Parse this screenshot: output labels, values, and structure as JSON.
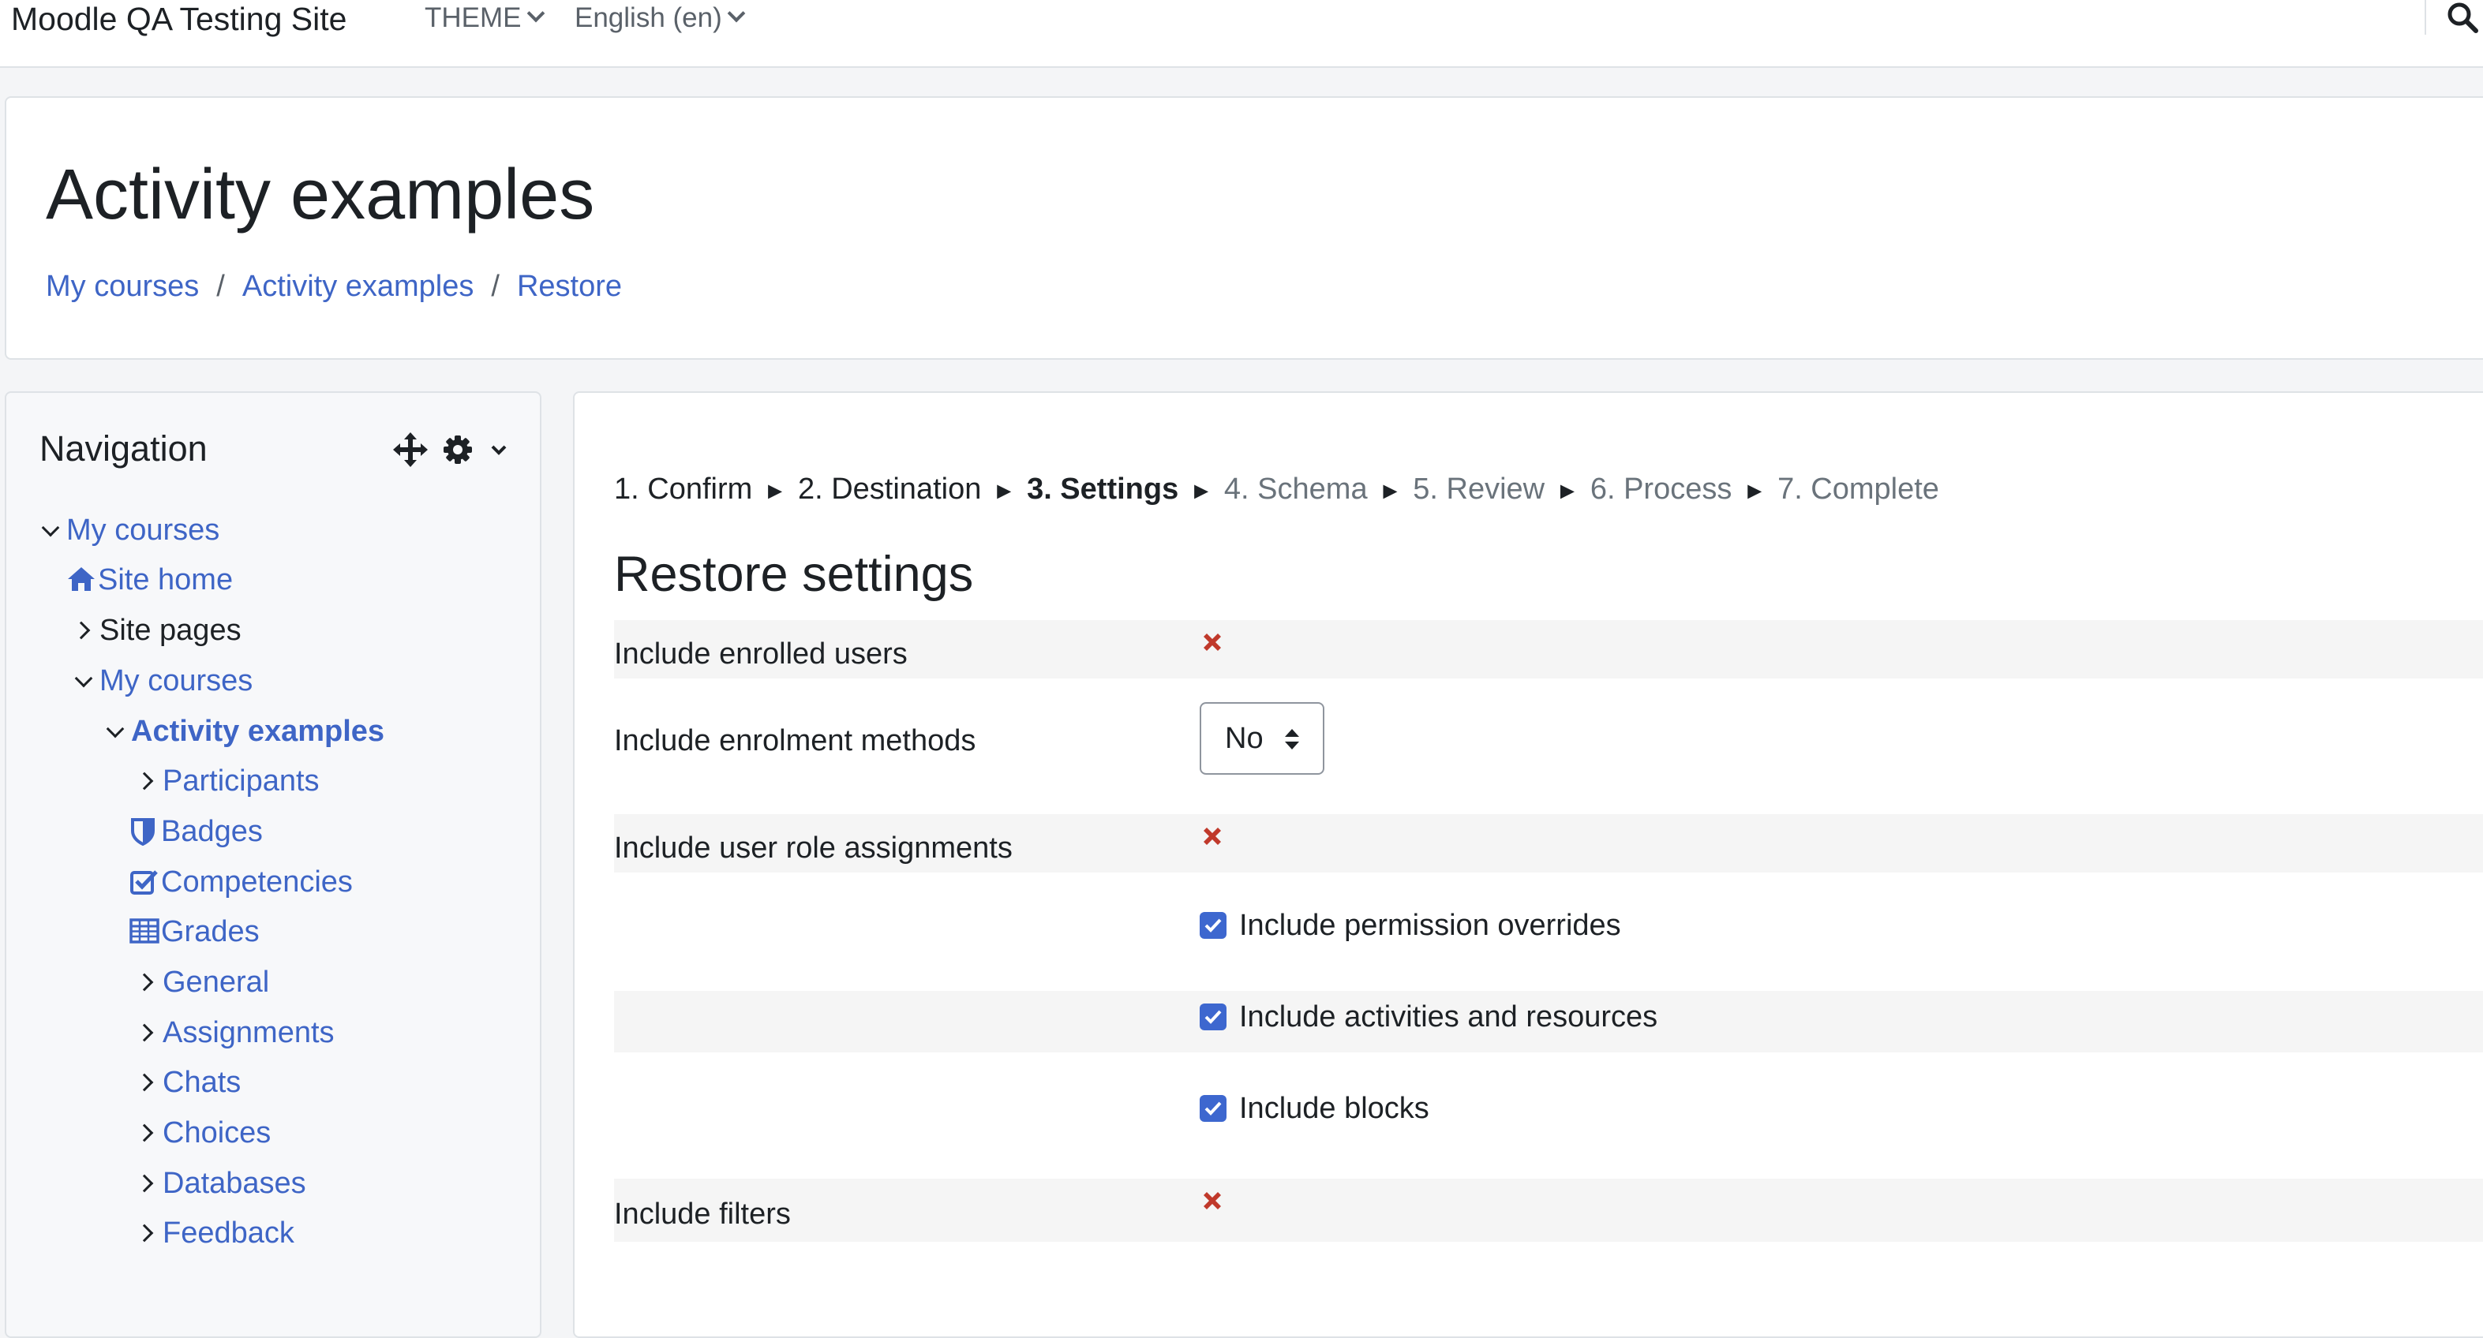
{
  "topbar": {
    "site_name": "Moodle QA Testing Site",
    "theme_menu": "THEME",
    "language_menu": "English (en)"
  },
  "header": {
    "title": "Activity examples",
    "breadcrumb": [
      "My courses",
      "Activity examples",
      "Restore"
    ]
  },
  "navigation": {
    "title": "Navigation",
    "items": [
      {
        "label": "My courses",
        "icon": "chevron-down-icon"
      },
      {
        "label": "Site home",
        "icon": "home-icon"
      },
      {
        "label": "Site pages",
        "icon": "chevron-right-icon"
      },
      {
        "label": "My courses",
        "icon": "chevron-down-icon"
      },
      {
        "label": "Activity examples",
        "icon": "chevron-down-icon"
      },
      {
        "label": "Participants",
        "icon": "chevron-right-icon"
      },
      {
        "label": "Badges",
        "icon": "shield-icon"
      },
      {
        "label": "Competencies",
        "icon": "check-square-icon"
      },
      {
        "label": "Grades",
        "icon": "table-icon"
      },
      {
        "label": "General",
        "icon": "chevron-right-icon"
      },
      {
        "label": "Assignments",
        "icon": "chevron-right-icon"
      },
      {
        "label": "Chats",
        "icon": "chevron-right-icon"
      },
      {
        "label": "Choices",
        "icon": "chevron-right-icon"
      },
      {
        "label": "Databases",
        "icon": "chevron-right-icon"
      },
      {
        "label": "Feedback",
        "icon": "chevron-right-icon"
      }
    ]
  },
  "steps": [
    {
      "label": "1. Confirm",
      "state": "done"
    },
    {
      "label": "2. Destination",
      "state": "done"
    },
    {
      "label": "3. Settings",
      "state": "current"
    },
    {
      "label": "4. Schema",
      "state": "future"
    },
    {
      "label": "5. Review",
      "state": "future"
    },
    {
      "label": "6. Process",
      "state": "future"
    },
    {
      "label": "7. Complete",
      "state": "future"
    }
  ],
  "settings": {
    "title": "Restore settings",
    "enrolled_users": {
      "label": "Include enrolled users",
      "value": "disabled"
    },
    "enrolment_methods": {
      "label": "Include enrolment methods",
      "value": "No"
    },
    "role_assignments": {
      "label": "Include user role assignments",
      "value": "disabled"
    },
    "permission_overrides": {
      "label": "Include permission overrides",
      "checked": true
    },
    "activities": {
      "label": "Include activities and resources",
      "checked": true
    },
    "blocks": {
      "label": "Include blocks",
      "checked": true
    },
    "filters": {
      "label": "Include filters",
      "value": "disabled"
    }
  },
  "colors": {
    "link": "#3e65c6",
    "cross": "#c0392b",
    "checkbox": "#3d67cf",
    "stripe": "#f5f5f5"
  }
}
